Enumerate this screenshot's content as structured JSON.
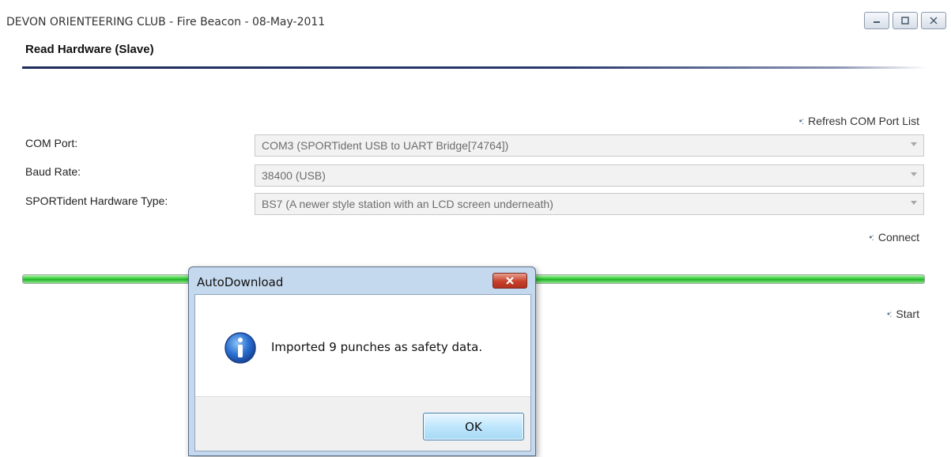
{
  "window": {
    "title": "DEVON ORIENTEERING CLUB - Fire Beacon - 08-May-2011",
    "controls": [
      "minimize-icon",
      "maximize-icon",
      "close-icon"
    ]
  },
  "section": {
    "title": "Read Hardware (Slave)"
  },
  "actions": {
    "refresh": "Refresh COM Port List",
    "connect": "Connect",
    "start": "Start"
  },
  "form": {
    "com_port": {
      "label": "COM Port:",
      "value": "COM3 (SPORTident USB to UART Bridge[74764])"
    },
    "baud_rate": {
      "label": "Baud Rate:",
      "value": "38400 (USB)"
    },
    "hardware_type": {
      "label": "SPORTident Hardware Type:",
      "value": "BS7 (A newer style station with an LCD screen underneath)"
    }
  },
  "progress": {
    "value": 1.0,
    "color": "#2fbf35"
  },
  "dialog": {
    "title": "AutoDownload",
    "message": "Imported 9 punches as safety data.",
    "ok_label": "OK",
    "icon": "info-icon"
  },
  "colors": {
    "accent_rule": "#1c2b5a",
    "dialog_frame": "#c5d9ee",
    "close_red": "#c7402b"
  }
}
